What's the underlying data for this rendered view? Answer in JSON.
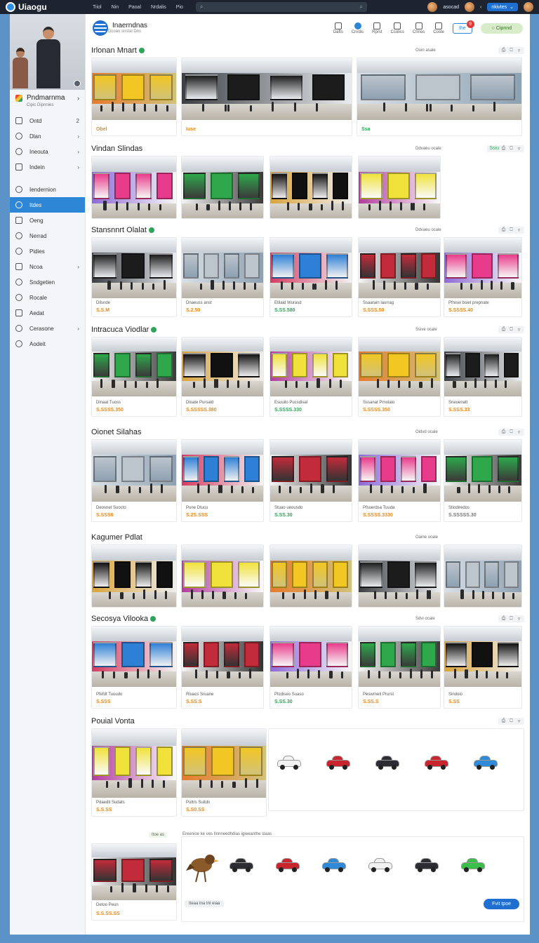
{
  "topbar": {
    "logo": "Uiaogu",
    "nav": [
      "Tiiol",
      "Nin",
      "Paoal",
      "Nrdalis",
      "Pio"
    ],
    "right_label": "asocad",
    "account": "nkivtes"
  },
  "sidebar": {
    "brand": "Pndmarnma",
    "brand_sub": "Cipic Dipnnies",
    "items": [
      {
        "label": "Ontd",
        "ext": "2"
      },
      {
        "label": "Dlan",
        "ext": "›"
      },
      {
        "label": "Ineouta",
        "ext": "›"
      },
      {
        "label": "Indein",
        "ext": "›"
      },
      {
        "label": "Iendernion",
        "ext": ""
      },
      {
        "label": "Itdes",
        "ext": ""
      },
      {
        "label": "Oeng",
        "ext": ""
      },
      {
        "label": "Nerrad",
        "ext": ""
      },
      {
        "label": "Pidies",
        "ext": ""
      },
      {
        "label": "Ncoa",
        "ext": "›"
      },
      {
        "label": "Sndgetien",
        "ext": ""
      },
      {
        "label": "Rocale",
        "ext": ""
      },
      {
        "label": "Aedat",
        "ext": ""
      },
      {
        "label": "Cerasone",
        "ext": "›"
      },
      {
        "label": "Aodeit",
        "ext": ""
      }
    ]
  },
  "header": {
    "title": "Inaerndnas",
    "subtitle": "Dcoan snstal Dns",
    "tools": [
      "Dafts",
      "Cnrdis",
      "Rprst",
      "Ccolics",
      "Cnnos",
      "Coste"
    ],
    "notif_label": "Ihe",
    "notif_count": "9",
    "action_label": "Cipnnd"
  },
  "sections": [
    {
      "title": "Irlonan Mnart",
      "meta": "Ouin asale",
      "cards": [
        {
          "caption": "",
          "rating": "Obel"
        },
        {
          "caption": "",
          "rating": "Iuse"
        },
        {
          "caption": "",
          "rating": "Ssa"
        }
      ]
    },
    {
      "title": "Vindan Slindas",
      "meta": "Ddvaeu ocale",
      "badge": "Ssiu",
      "cards": [
        {
          "caption": "",
          "rating": ""
        },
        {
          "caption": "",
          "rating": ""
        },
        {
          "caption": "",
          "rating": ""
        },
        {
          "caption": "",
          "rating": ""
        }
      ]
    },
    {
      "title": "Stansnnrt Olalat",
      "meta": "Ddvaeu ocale",
      "cards": [
        {
          "caption": "Dilsnde",
          "rating": "S.S.M"
        },
        {
          "caption": "Dnaeuss anst",
          "rating": "S.2.50"
        },
        {
          "caption": "Etilaid Wurasd",
          "rating": "S.SS.580"
        },
        {
          "caption": "Ssaarain laurrag",
          "rating": "S.SSS.50"
        },
        {
          "caption": "Pfnisei bsiet prepnate",
          "rating": "S.SSSS.40"
        }
      ]
    },
    {
      "title": "Intracuca Viodlar",
      "meta": "Ssive ocale",
      "cards": [
        {
          "caption": "Dinaat Tuoss",
          "rating": "S.SSSS.350"
        },
        {
          "caption": "Dloate Pursald",
          "rating": "S.SSSSS.380"
        },
        {
          "caption": "Esuuilo Pucsdisal",
          "rating": "S.SSSS.330"
        },
        {
          "caption": "Sssanat Prnolaio",
          "rating": "S.SSSS.350"
        },
        {
          "caption": "Sneuenatt",
          "rating": "S.SSS.33"
        }
      ]
    },
    {
      "title": "Oionet Silahas",
      "meta": "Oidvd ocale",
      "cards": [
        {
          "caption": "Deosnet Suocto",
          "rating": "S.SSS6"
        },
        {
          "caption": "Pune Dtucu",
          "rating": "S.2S.SSS"
        },
        {
          "caption": "Stuao ueousdo",
          "rating": "S.SS.30"
        },
        {
          "caption": "Pfsuerdsa Tuuda",
          "rating": "S.SSSS.3330"
        },
        {
          "caption": "Stiodiredos",
          "rating": "S.SSSSS.30"
        }
      ]
    },
    {
      "title": "Kagumer Pdlat",
      "meta": "Oaine ocale",
      "cards": [
        {
          "caption": "",
          "rating": ""
        },
        {
          "caption": "",
          "rating": ""
        },
        {
          "caption": "",
          "rating": ""
        },
        {
          "caption": "",
          "rating": ""
        },
        {
          "caption": "",
          "rating": ""
        }
      ]
    },
    {
      "title": "Secosya Vilooka",
      "meta": "Sdvi ocale",
      "cards": [
        {
          "caption": "Pfefdt Tuoudo",
          "rating": "S.SSS"
        },
        {
          "caption": "Rluacs Sruane",
          "rating": "S.SS.S"
        },
        {
          "caption": "Ptcdiseo Suaso",
          "rating": "S.SS.30"
        },
        {
          "caption": "Peswrneit Prurst",
          "rating": "S.SS.S"
        },
        {
          "caption": "Sindoio",
          "rating": "S.SS"
        }
      ]
    },
    {
      "title": "Pouial Vonta",
      "meta": "",
      "cards": [
        {
          "caption": "Pdaedit Sudats",
          "rating": "S.S.SS"
        },
        {
          "caption": "Puttrs Suitdn",
          "rating": "S.S0.SS"
        }
      ],
      "cars": [
        "white",
        "red",
        "black",
        "red",
        "blue"
      ]
    },
    {
      "title": "",
      "meta": "",
      "gap_label": "Itoe as",
      "gap_text": "Ereenioe ke ves Ilnnneedhdias igleeanthe slaas",
      "cards": [
        {
          "caption": "Detoo Peun",
          "rating": "S.S.SS.SS"
        }
      ],
      "cars": [
        "black",
        "red",
        "blue",
        "white",
        "black",
        "green"
      ],
      "pill": "Iteaa tna tnl eiaa",
      "float_button": "Fvit tpoe"
    }
  ],
  "colors": {
    "accent": "#2e86d6",
    "verified": "#2fa35a",
    "rating": "#e08a1c",
    "topbar": "#1d2430"
  }
}
